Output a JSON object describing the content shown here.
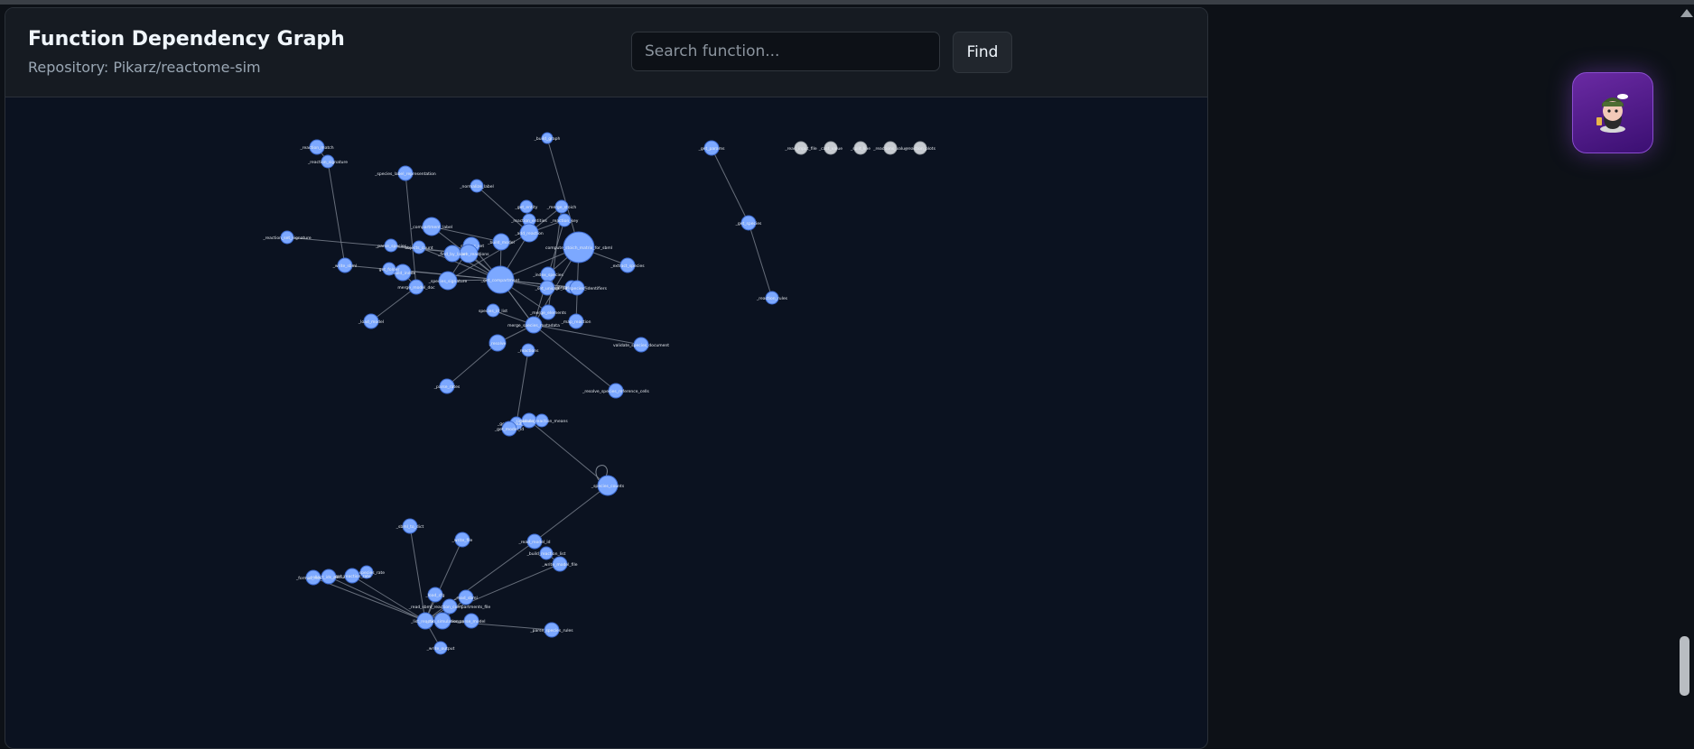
{
  "page": {
    "title": "Function Dependency Graph",
    "subtitle": "Repository: Pikarz/reactome-sim"
  },
  "search": {
    "placeholder": "Search function...",
    "value": "",
    "button_label": "Find"
  },
  "colors": {
    "node_fill": "#7ca8ff",
    "node_stroke": "#3d6bd1",
    "isolated_node_fill": "#c7cbd1",
    "edge": "#7d8591",
    "background": "#0b1220"
  },
  "avatar": {
    "icon": "octocat-avatar-icon"
  },
  "graph": {
    "nodes": [
      {
        "id": "n1",
        "label": "_reaction_match"
      },
      {
        "id": "n2",
        "label": "_reaction_signature"
      },
      {
        "id": "n3",
        "label": "_species_label_representation"
      },
      {
        "id": "n4",
        "label": "_reaction_set_signature"
      },
      {
        "id": "n5",
        "label": "_parse_species"
      },
      {
        "id": "n6",
        "label": "_compartment_label"
      },
      {
        "id": "n7",
        "label": "_species_set"
      },
      {
        "id": "n8",
        "label": "_normalize_label"
      },
      {
        "id": "n9",
        "label": "_get_entity"
      },
      {
        "id": "n10",
        "label": "_reaction_entities"
      },
      {
        "id": "n11",
        "label": "_merge_stoich"
      },
      {
        "id": "n12",
        "label": "_reaction_key"
      },
      {
        "id": "n13",
        "label": "_add_reaction"
      },
      {
        "id": "n14",
        "label": "_build_model"
      },
      {
        "id": "n15",
        "label": "_compare_reactions"
      },
      {
        "id": "n16",
        "label": "_find_by_label"
      },
      {
        "id": "n17",
        "label": "compute_stoich_matrix_for_sbml"
      },
      {
        "id": "n18",
        "label": "_extract_species"
      },
      {
        "id": "n19",
        "label": "merge_models"
      },
      {
        "id": "n20",
        "label": "_index_species"
      },
      {
        "id": "n21",
        "label": "_get_compartment"
      },
      {
        "id": "n22",
        "label": "_species_signature"
      },
      {
        "id": "n23",
        "label": "_build_index"
      },
      {
        "id": "n24",
        "label": "merge_model_doc"
      },
      {
        "id": "n25",
        "label": "merge_all_species_identifiers"
      },
      {
        "id": "n26",
        "label": "_set_unique"
      },
      {
        "id": "n27",
        "label": "_write_sbml"
      },
      {
        "id": "n28",
        "label": "_load_model"
      },
      {
        "id": "n29",
        "label": "merge_species_metadata"
      },
      {
        "id": "n30",
        "label": "_merge_elements"
      },
      {
        "id": "n31",
        "label": "_map_reaction"
      },
      {
        "id": "n32",
        "label": "validate_species_document"
      },
      {
        "id": "n33",
        "label": "_resolve"
      },
      {
        "id": "n34",
        "label": "_reactions"
      },
      {
        "id": "n35",
        "label": "_resolve_species_reference_cells"
      },
      {
        "id": "n36",
        "label": "_parse_rates"
      },
      {
        "id": "n37",
        "label": "_get_output_folder"
      },
      {
        "id": "n38",
        "label": "simulate"
      },
      {
        "id": "n39",
        "label": "simulate_reaction_means"
      },
      {
        "id": "n40",
        "label": "_get_model_id"
      },
      {
        "id": "n41",
        "label": "_species_counts"
      },
      {
        "id": "n42",
        "label": "_sbml_to_dict"
      },
      {
        "id": "n43",
        "label": "_write_file"
      },
      {
        "id": "n44",
        "label": "_read_model_id"
      },
      {
        "id": "n45",
        "label": "_build_reaction_list"
      },
      {
        "id": "n46",
        "label": "_write_model_file"
      },
      {
        "id": "n47",
        "label": "_get_species_rate"
      },
      {
        "id": "n48",
        "label": "_format_reaction"
      },
      {
        "id": "n49",
        "label": "_collect_ids_missing"
      },
      {
        "id": "n50",
        "label": "_get_reaction_rate"
      },
      {
        "id": "n51",
        "label": "_load_cfg"
      },
      {
        "id": "n52",
        "label": "_read_sbml"
      },
      {
        "id": "n53",
        "label": "_read_sbml_reaction_compartments_file"
      },
      {
        "id": "n54",
        "label": "_list_reactions"
      },
      {
        "id": "n55",
        "label": "_run_simulation"
      },
      {
        "id": "n56",
        "label": "_parse_model"
      },
      {
        "id": "n57",
        "label": "_parse_species_rules"
      },
      {
        "id": "n58",
        "label": "_write_output"
      },
      {
        "id": "n59",
        "label": "_get_params"
      },
      {
        "id": "n60",
        "label": "_get_species"
      },
      {
        "id": "n61",
        "label": "_reaction_rules"
      },
      {
        "id": "n62",
        "label": "_build_graph"
      },
      {
        "id": "n63",
        "label": "get_folder"
      },
      {
        "id": "n64",
        "label": "objects_count"
      },
      {
        "id": "n65",
        "label": "species_id_list"
      },
      {
        "id": "n66",
        "label": "_read_input_file"
      },
      {
        "id": "n67",
        "label": "_cast_value"
      },
      {
        "id": "n68",
        "label": "_split_line"
      },
      {
        "id": "n69",
        "label": "_reactions_value"
      },
      {
        "id": "n70",
        "label": "_reaction_plots"
      }
    ]
  }
}
